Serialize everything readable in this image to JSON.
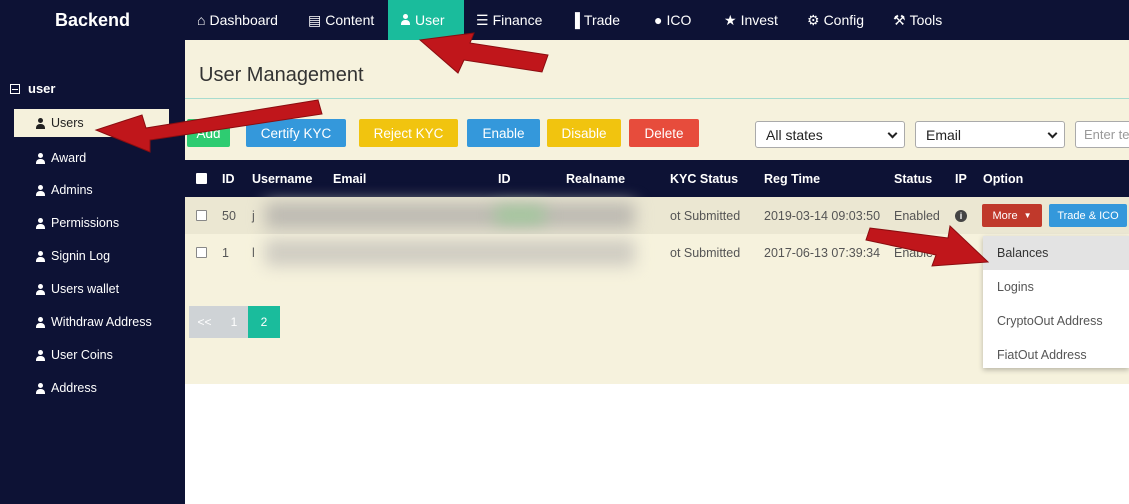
{
  "brand": "Backend",
  "nav": [
    {
      "label": "Dashboard",
      "icon": "home-icon",
      "glyph": "⌂"
    },
    {
      "label": "Content",
      "icon": "list-box-icon",
      "glyph": "▤"
    },
    {
      "label": "User",
      "icon": "user-icon",
      "glyph": "",
      "active": true
    },
    {
      "label": "Finance",
      "icon": "list-icon",
      "glyph": "☰"
    },
    {
      "label": "Trade",
      "icon": "bar-chart-icon",
      "glyph": "▐"
    },
    {
      "label": "ICO",
      "icon": "globe-icon",
      "glyph": "●"
    },
    {
      "label": "Invest",
      "icon": "star-icon",
      "glyph": "★"
    },
    {
      "label": "Config",
      "icon": "gear-icon",
      "glyph": "⚙"
    },
    {
      "label": "Tools",
      "icon": "wrench-icon",
      "glyph": "⚒"
    }
  ],
  "sidebar": {
    "group": "user",
    "items": [
      {
        "label": "Users",
        "active": true
      },
      {
        "label": "Award"
      },
      {
        "label": "Admins"
      },
      {
        "label": "Permissions"
      },
      {
        "label": "Signin Log"
      },
      {
        "label": "Users wallet"
      },
      {
        "label": "Withdraw Address"
      },
      {
        "label": "User Coins"
      },
      {
        "label": "Address"
      }
    ]
  },
  "main": {
    "title": "User Management",
    "buttons": {
      "add": "Add",
      "certify_kyc": "Certify KYC",
      "reject_kyc": "Reject KYC",
      "enable": "Enable",
      "disable": "Disable",
      "delete": "Delete"
    },
    "filters": {
      "state": "All states",
      "field": "Email",
      "search_placeholder": "Enter te"
    }
  },
  "table": {
    "headers": {
      "id": "ID",
      "username": "Username",
      "email": "Email",
      "id2": "ID",
      "realname": "Realname",
      "kyc": "KYC Status",
      "reg_time": "Reg Time",
      "status": "Status",
      "ip": "IP",
      "option": "Option"
    },
    "rows": [
      {
        "id": "50",
        "username": "j",
        "kyc": "ot Submitted",
        "reg_time": "2019-03-14 09:03:50",
        "status": "Enabled",
        "more": "More",
        "trade": "Trade & ICO"
      },
      {
        "id": "1",
        "username": "l",
        "kyc": "ot Submitted",
        "reg_time": "2017-06-13 07:39:34",
        "status": "Enable"
      }
    ]
  },
  "pagination": {
    "prev": "<<",
    "pages": [
      "1",
      "2"
    ],
    "current": "2"
  },
  "dropdown": {
    "items": [
      "Balances",
      "Logins",
      "CryptoOut Address",
      "FiatOut Address"
    ],
    "hovered": "Balances"
  },
  "colors": {
    "nav_bg": "#0d1235",
    "active_teal": "#1abc9c",
    "panel_bg": "#f6f2dd",
    "btn_green": "#2ecc71",
    "btn_blue": "#3498db",
    "btn_yellow": "#f1c40f",
    "btn_red": "#e74c3c",
    "btn_more": "#c0392b",
    "arrow_red": "#c0161b"
  }
}
